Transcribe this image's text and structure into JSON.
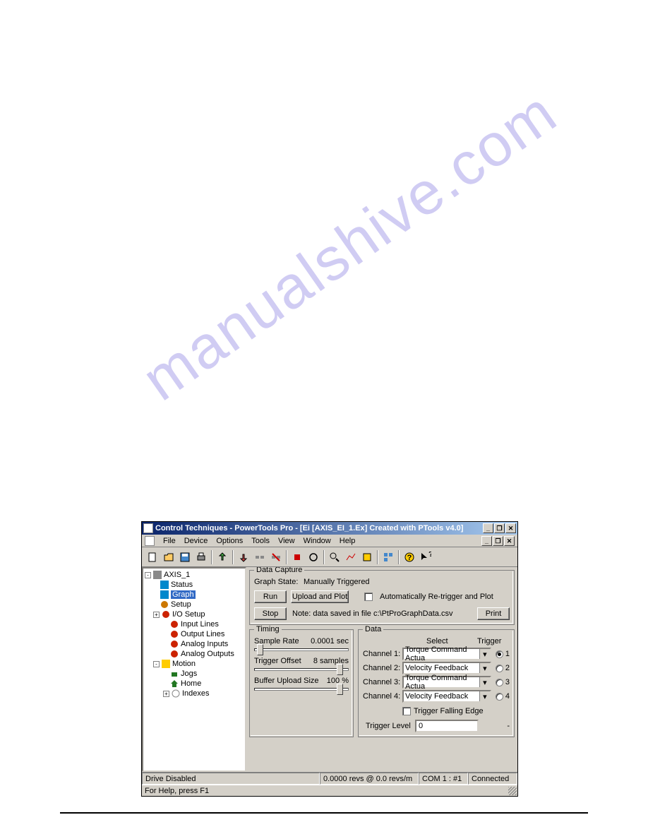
{
  "watermark": "manualshive.com",
  "titlebar": "Control Techniques - PowerTools Pro - [Ei   [AXIS_EI_1.Ex] Created with PTools v4.0]",
  "menu": [
    "File",
    "Device",
    "Options",
    "Tools",
    "View",
    "Window",
    "Help"
  ],
  "tree": {
    "root": "AXIS_1",
    "items": [
      {
        "label": "Status",
        "indent": 1,
        "color": "#0088cc"
      },
      {
        "label": "Graph",
        "indent": 1,
        "color": "#0088cc",
        "selected": true
      },
      {
        "label": "Setup",
        "indent": 1,
        "color": "#cc7700"
      },
      {
        "label": "I/O Setup",
        "indent": 1,
        "color": "#cc2200",
        "exp": "+"
      },
      {
        "label": "Input Lines",
        "indent": 2,
        "color": "#cc2200"
      },
      {
        "label": "Output Lines",
        "indent": 2,
        "color": "#cc2200"
      },
      {
        "label": "Analog Inputs",
        "indent": 2,
        "color": "#cc2200"
      },
      {
        "label": "Analog Outputs",
        "indent": 2,
        "color": "#cc2200"
      },
      {
        "label": "Motion",
        "indent": 1,
        "color": "#00aa00",
        "exp": "-"
      },
      {
        "label": "Jogs",
        "indent": 2,
        "color": "#227722"
      },
      {
        "label": "Home",
        "indent": 2,
        "color": "#227722"
      },
      {
        "label": "Indexes",
        "indent": 2,
        "color": "#888888",
        "exp": "+"
      }
    ]
  },
  "capture": {
    "title": "Data Capture",
    "state_label": "Graph State:",
    "state_value": "Manually Triggered",
    "run": "Run",
    "upload": "Upload and Plot",
    "stop": "Stop",
    "auto": "Automatically Re-trigger and Plot",
    "note": "Note: data saved in file c:\\PtProGraphData.csv",
    "print": "Print"
  },
  "timing": {
    "title": "Timing",
    "sample_label": "Sample Rate",
    "sample_value": "0.0001",
    "sample_unit": "sec",
    "trigger_label": "Trigger Offset",
    "trigger_value": "8",
    "trigger_unit": "samples",
    "buffer_label": "Buffer Upload Size",
    "buffer_value": "100",
    "buffer_unit": "%"
  },
  "data": {
    "title": "Data",
    "select_header": "Select",
    "trigger_header": "Trigger",
    "channels": [
      {
        "label": "Channel 1:",
        "value": "Torque Command Actua",
        "radio": "1",
        "checked": true
      },
      {
        "label": "Channel 2:",
        "value": "Velocity Feedback",
        "radio": "2"
      },
      {
        "label": "Channel 3:",
        "value": "Torque Command Actua",
        "radio": "3"
      },
      {
        "label": "Channel 4:",
        "value": "Velocity Feedback",
        "radio": "4"
      }
    ],
    "falling_edge": "Trigger Falling Edge",
    "trigger_level_label": "Trigger Level",
    "trigger_level_value": "0",
    "trigger_level_unit": "-"
  },
  "status": {
    "drive": "Drive Disabled",
    "pos": "0.0000 revs @ 0.0 revs/m",
    "com": "COM 1 : #1",
    "conn": "Connected",
    "help": "For Help, press F1"
  }
}
